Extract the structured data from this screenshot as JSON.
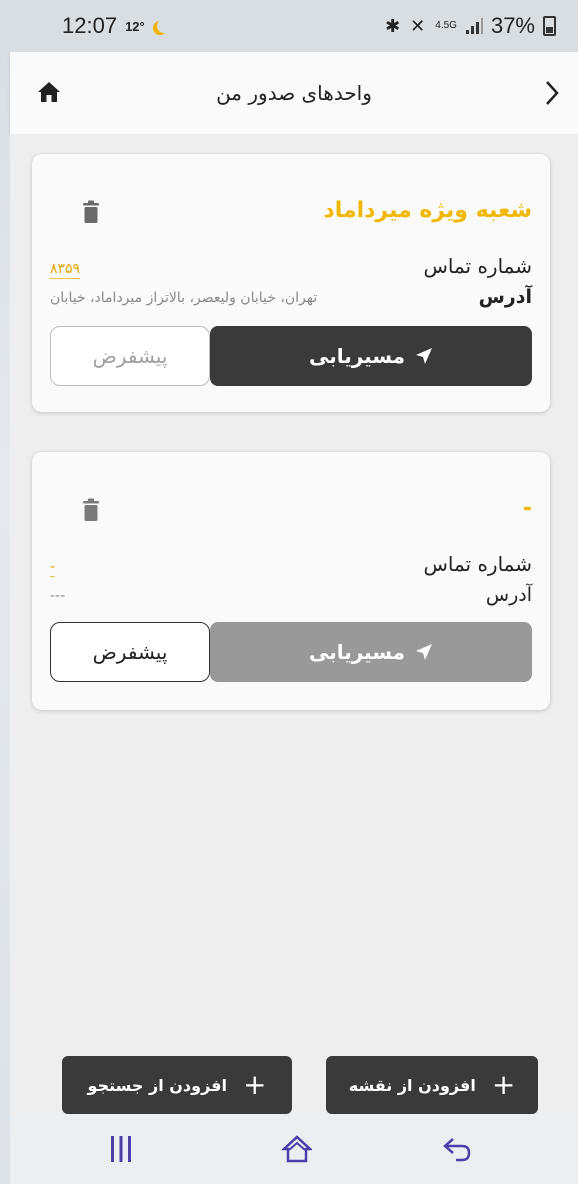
{
  "status_bar": {
    "time": "12:07",
    "temperature": "12°",
    "network": "4.5G",
    "battery": "37%"
  },
  "header": {
    "title": "واحدهای صدور من"
  },
  "cards": [
    {
      "title": "شعبه ویژه میرداماد",
      "phone_label": "شماره تماس",
      "phone_value": "۸۳۵۹",
      "address_label": "آدرس",
      "address_value": "تهران، خیابان ولیعصر، بالاتراز میرداماد، خیابان",
      "route_label": "مسیریابی",
      "default_label": "پیشفرض"
    },
    {
      "title": "-",
      "phone_label": "شماره تماس",
      "phone_value": "-",
      "address_label": "آدرس",
      "address_value": "---",
      "route_label": "مسیریابی",
      "default_label": "پیشفرض"
    }
  ],
  "actions": {
    "add_from_map": "افزودن از نقشه",
    "add_from_search": "افزودن از جستجو"
  },
  "colors": {
    "accent": "#f0b800",
    "dark_button": "#3a3a3a",
    "disabled_button": "#999999"
  }
}
